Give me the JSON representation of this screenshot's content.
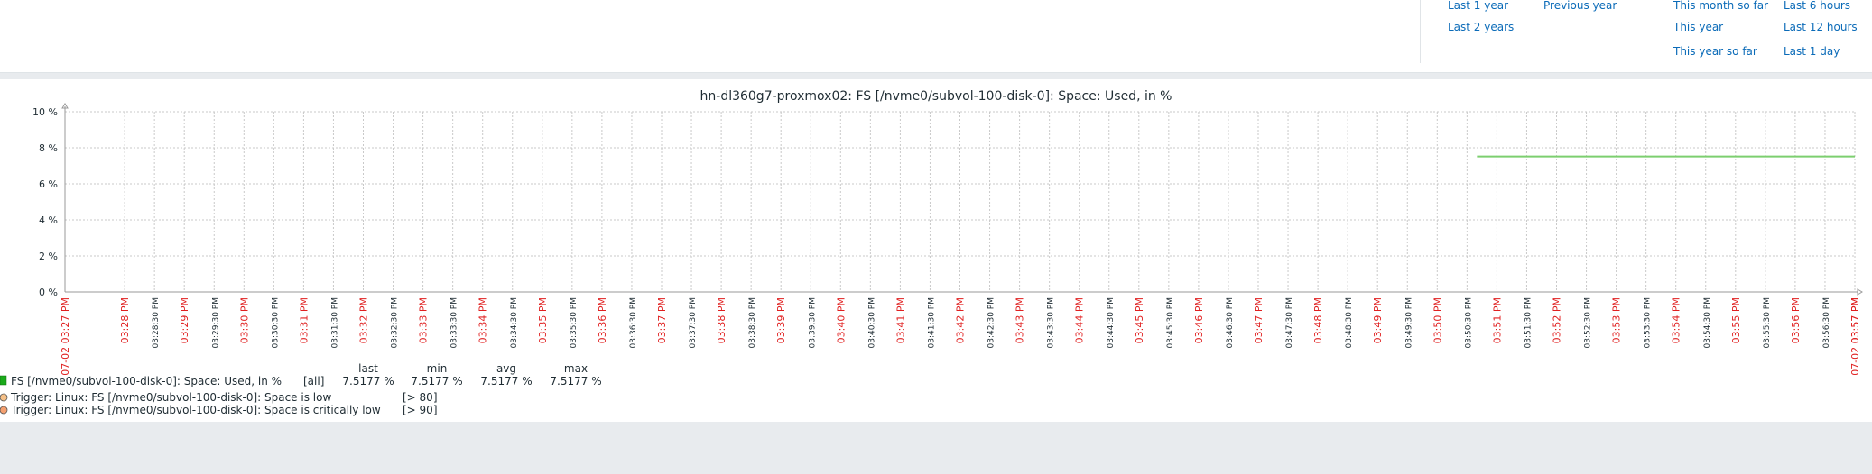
{
  "period_selector": {
    "links": [
      "Last 1 year",
      "Previous year",
      "This month so far",
      "Last 6 hours",
      "Last 2 years",
      "This year",
      "Last 12 hours",
      "This year so far",
      "Last 1 day"
    ]
  },
  "chart_data": {
    "type": "line",
    "title": "hn-dl360g7-proxmox02: FS [/nvme0/subvol-100-disk-0]: Space: Used, in %",
    "ylim": [
      0,
      10
    ],
    "yticks": [
      "0 %",
      "2 %",
      "4 %",
      "6 %",
      "8 %",
      "10 %"
    ],
    "xaxis": {
      "start_label": "07-02 03:27 PM",
      "end_label": "07-02 03:57 PM",
      "major_labels": [
        "03:28 PM",
        "03:29 PM",
        "03:30 PM",
        "03:31 PM",
        "03:32 PM",
        "03:33 PM",
        "03:34 PM",
        "03:35 PM",
        "03:36 PM",
        "03:37 PM",
        "03:38 PM",
        "03:39 PM",
        "03:40 PM",
        "03:41 PM",
        "03:42 PM",
        "03:43 PM",
        "03:44 PM",
        "03:45 PM",
        "03:46 PM",
        "03:47 PM",
        "03:48 PM",
        "03:49 PM",
        "03:50 PM",
        "03:51 PM",
        "03:52 PM",
        "03:53 PM",
        "03:54 PM",
        "03:55 PM",
        "03:56 PM",
        "03:57 PM"
      ],
      "minor_labels": [
        "03:28:30 PM",
        "03:29:30 PM",
        "03:30:30 PM",
        "03:31:30 PM",
        "03:32:30 PM",
        "03:33:30 PM",
        "03:34:30 PM",
        "03:35:30 PM",
        "03:36:30 PM",
        "03:37:30 PM",
        "03:38:30 PM",
        "03:39:30 PM",
        "03:40:30 PM",
        "03:41:30 PM",
        "03:42:30 PM",
        "03:43:30 PM",
        "03:44:30 PM",
        "03:45:30 PM",
        "03:46:30 PM",
        "03:47:30 PM",
        "03:48:30 PM",
        "03:49:30 PM",
        "03:50:30 PM",
        "03:51:30 PM",
        "03:52:30 PM",
        "03:53:30 PM",
        "03:54:30 PM",
        "03:55:30 PM",
        "03:56:30 PM"
      ]
    },
    "series": [
      {
        "name": "FS [/nvme0/subvol-100-disk-0]: Space: Used, in %",
        "color": "#7ccf6f",
        "points": [
          {
            "x": "03:50:40 PM",
            "y": 7.5177
          },
          {
            "x": "03:57:00 PM",
            "y": 7.5177
          }
        ]
      }
    ],
    "legend": {
      "headers": [
        "last",
        "min",
        "avg",
        "max"
      ],
      "item": {
        "color": "#1aaa1a",
        "label": "FS [/nvme0/subvol-100-disk-0]: Space: Used, in %",
        "func": "[all]",
        "last": "7.5177 %",
        "min": "7.5177 %",
        "avg": "7.5177 %",
        "max": "7.5177 %"
      },
      "triggers": [
        {
          "label": "Trigger: Linux: FS [/nvme0/subvol-100-disk-0]: Space is low",
          "threshold": "[> 80]",
          "color": "#f5c088"
        },
        {
          "label": "Trigger: Linux: FS [/nvme0/subvol-100-disk-0]: Space is critically low",
          "threshold": "[> 90]",
          "color": "#f5a070"
        }
      ]
    },
    "grid": true
  }
}
